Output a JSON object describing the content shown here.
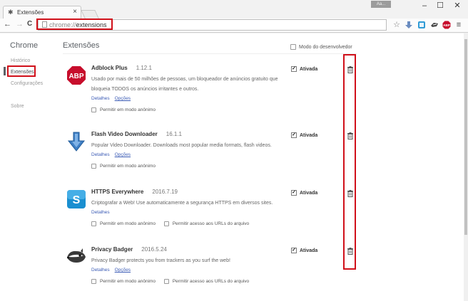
{
  "tab": {
    "title": "Extensões",
    "close": "×"
  },
  "window": {
    "user_chip": "Aa...",
    "minimize": "–",
    "maximize": "☐",
    "close": "✕"
  },
  "toolbar": {
    "back": "←",
    "forward": "→",
    "reload": "C",
    "url_scheme": "chrome://",
    "url_host": "extensions",
    "star": "☆",
    "abp_badge": "ABP",
    "menu": "≡"
  },
  "sidebar": {
    "title": "Chrome",
    "items": [
      {
        "label": "Histórico"
      },
      {
        "label": "Extensões"
      },
      {
        "label": "Configurações"
      },
      {
        "label": "Sobre"
      }
    ]
  },
  "main": {
    "title": "Extensões",
    "dev_mode_label": "Modo do desenvolvedor"
  },
  "extensions": [
    {
      "name": "Adblock Plus",
      "version": "1.12.1",
      "icon": "adblock-plus-icon",
      "icon_text": "ABP",
      "description": "Usado por mais de 50 milhões de pessoas, um bloqueador de anúncios gratuito que bloqueia TODOS os anúncios irritantes e outros.",
      "links": [
        "Detalhes",
        "Opções"
      ],
      "options": [
        "Permitir em modo anônimo"
      ],
      "enabled_label": "Ativada",
      "enabled": true
    },
    {
      "name": "Flash Video Downloader",
      "version": "16.1.1",
      "icon": "flash-video-downloader-icon",
      "description": "Popular Video Downloader. Downloads most popular media formats, flash videos.",
      "links": [
        "Detalhes",
        "Opções"
      ],
      "options": [
        "Permitir em modo anônimo"
      ],
      "enabled_label": "Ativada",
      "enabled": true
    },
    {
      "name": "HTTPS Everywhere",
      "version": "2016.7.19",
      "icon": "https-everywhere-icon",
      "icon_text": "S",
      "description": "Criptografar a Web! Use automaticamente a segurança HTTPS em diversos sites.",
      "links": [
        "Detalhes"
      ],
      "options": [
        "Permitir em modo anônimo",
        "Permitir acesso aos URLs do arquivo"
      ],
      "enabled_label": "Ativada",
      "enabled": true
    },
    {
      "name": "Privacy Badger",
      "version": "2016.5.24",
      "icon": "privacy-badger-icon",
      "description": "Privacy Badger protects you from trackers as you surf the web!",
      "links": [
        "Detalhes",
        "Opções"
      ],
      "options": [
        "Permitir em modo anônimo",
        "Permitir acesso aos URLs do arquivo"
      ],
      "enabled_label": "Ativada",
      "enabled": true
    }
  ],
  "colors": {
    "highlight": "#d0101a",
    "link": "#3b5bb5",
    "abp_red": "#c70d2c",
    "https_blue": "#1a8fd0"
  }
}
